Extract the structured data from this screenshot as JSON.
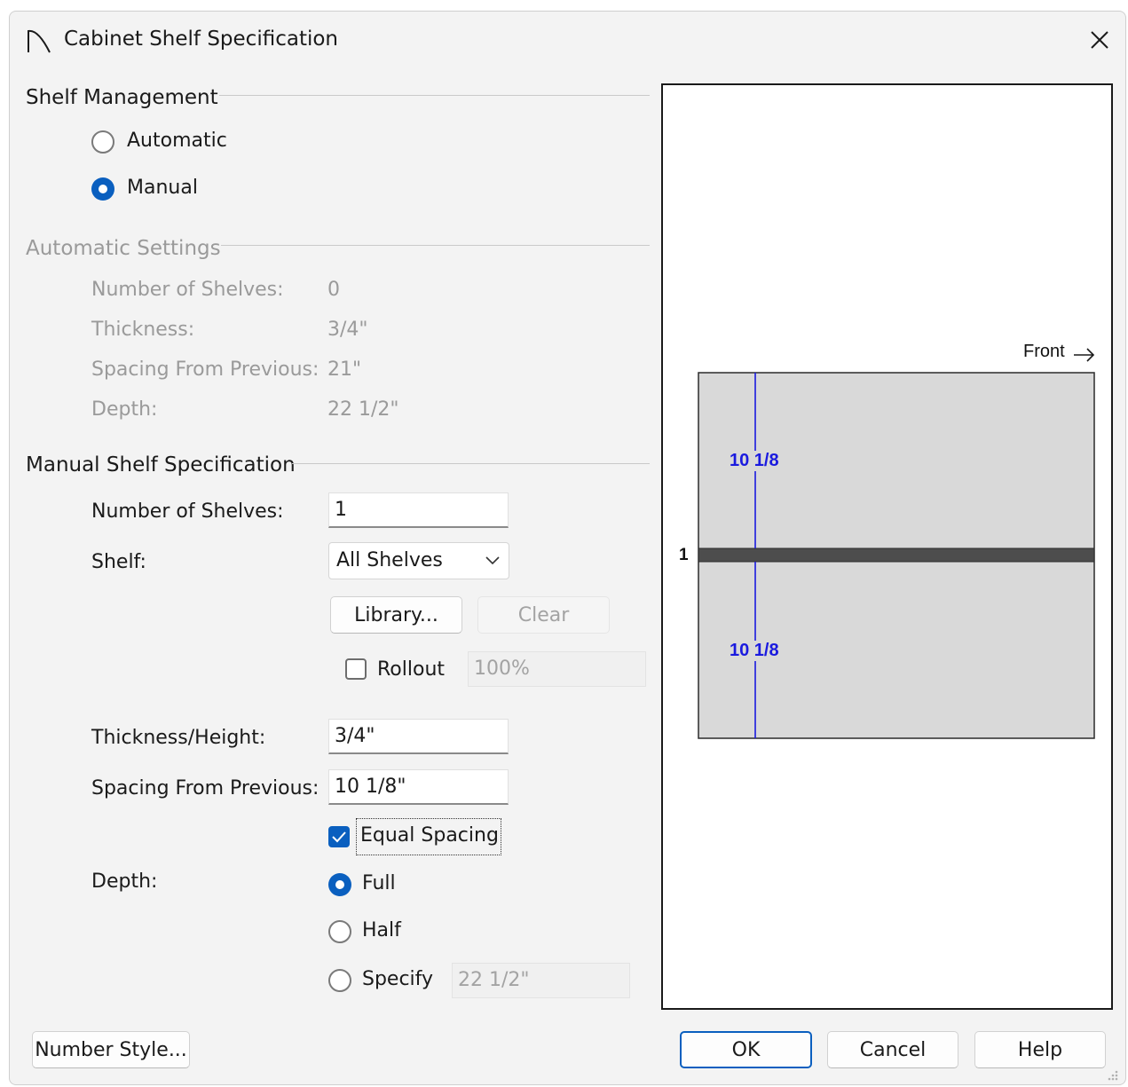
{
  "window": {
    "title": "Cabinet Shelf Specification"
  },
  "shelf_management": {
    "label": "Shelf Management",
    "options": [
      {
        "label": "Automatic",
        "selected": false
      },
      {
        "label": "Manual",
        "selected": true
      }
    ]
  },
  "automatic_settings": {
    "label": "Automatic Settings",
    "number_of_shelves": {
      "label": "Number of Shelves:",
      "value": "0"
    },
    "thickness": {
      "label": "Thickness:",
      "value": "3/4\""
    },
    "spacing_from_previous": {
      "label": "Spacing From Previous:",
      "value": "21\""
    },
    "depth": {
      "label": "Depth:",
      "value": "22 1/2\""
    }
  },
  "manual_spec": {
    "label": "Manual Shelf Specification",
    "number_of_shelves": {
      "label": "Number of Shelves:",
      "value": "1"
    },
    "shelf": {
      "label": "Shelf:",
      "value": "All Shelves"
    },
    "library_button": "Library...",
    "clear_button": "Clear",
    "rollout": {
      "label": "Rollout",
      "checked": false,
      "value": "100%"
    },
    "thickness_height": {
      "label": "Thickness/Height:",
      "value": "3/4\""
    },
    "spacing_from_previous": {
      "label": "Spacing From Previous:",
      "value": "10 1/8\""
    },
    "equal_spacing": {
      "label": "Equal Spacing",
      "checked": true
    },
    "depth": {
      "label": "Depth:",
      "options": [
        {
          "label": "Full",
          "selected": true
        },
        {
          "label": "Half",
          "selected": false
        },
        {
          "label": "Specify",
          "selected": false
        }
      ],
      "specify_value": "22 1/2\""
    }
  },
  "preview": {
    "front_label": "Front",
    "shelf_number": "1",
    "upper_spacing": "10 1/8",
    "lower_spacing": "10 1/8"
  },
  "buttons": {
    "number_style": "Number Style...",
    "ok": "OK",
    "cancel": "Cancel",
    "help": "Help"
  },
  "colors": {
    "accent": "#0a5fbf",
    "dimension": "#1a1adf",
    "cabinet_fill": "#d9d9d9",
    "shelf_fill": "#4d4d4d"
  }
}
